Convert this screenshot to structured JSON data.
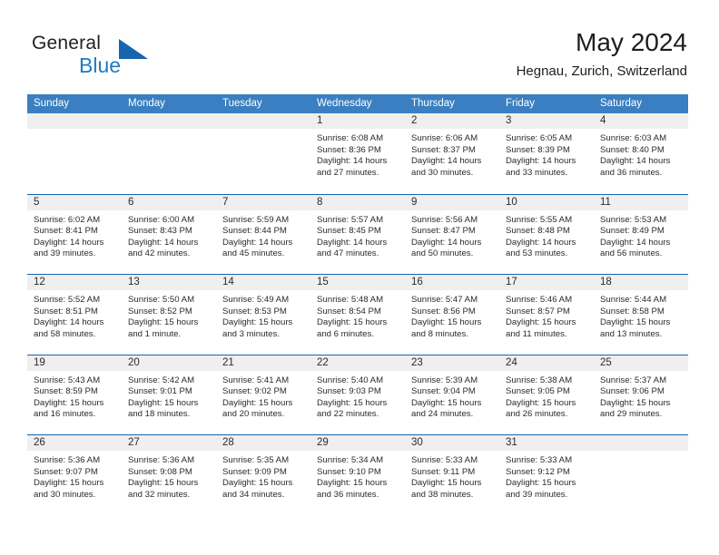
{
  "brand": {
    "name_part1": "General",
    "name_part2": "Blue"
  },
  "header": {
    "title": "May 2024",
    "location": "Hegnau, Zurich, Switzerland"
  },
  "weekdays": [
    "Sunday",
    "Monday",
    "Tuesday",
    "Wednesday",
    "Thursday",
    "Friday",
    "Saturday"
  ],
  "colors": {
    "header_blue": "#3a7fc1",
    "rule_blue": "#1665b0",
    "band_gray": "#efefef",
    "brand_blue": "#1f7ac4",
    "text": "#2b2b2b"
  },
  "weeks": [
    [
      {
        "day": "",
        "sunrise": "",
        "sunset": "",
        "daylight_line1": "",
        "daylight_line2": ""
      },
      {
        "day": "",
        "sunrise": "",
        "sunset": "",
        "daylight_line1": "",
        "daylight_line2": ""
      },
      {
        "day": "",
        "sunrise": "",
        "sunset": "",
        "daylight_line1": "",
        "daylight_line2": ""
      },
      {
        "day": "1",
        "sunrise": "Sunrise: 6:08 AM",
        "sunset": "Sunset: 8:36 PM",
        "daylight_line1": "Daylight: 14 hours",
        "daylight_line2": "and 27 minutes."
      },
      {
        "day": "2",
        "sunrise": "Sunrise: 6:06 AM",
        "sunset": "Sunset: 8:37 PM",
        "daylight_line1": "Daylight: 14 hours",
        "daylight_line2": "and 30 minutes."
      },
      {
        "day": "3",
        "sunrise": "Sunrise: 6:05 AM",
        "sunset": "Sunset: 8:39 PM",
        "daylight_line1": "Daylight: 14 hours",
        "daylight_line2": "and 33 minutes."
      },
      {
        "day": "4",
        "sunrise": "Sunrise: 6:03 AM",
        "sunset": "Sunset: 8:40 PM",
        "daylight_line1": "Daylight: 14 hours",
        "daylight_line2": "and 36 minutes."
      }
    ],
    [
      {
        "day": "5",
        "sunrise": "Sunrise: 6:02 AM",
        "sunset": "Sunset: 8:41 PM",
        "daylight_line1": "Daylight: 14 hours",
        "daylight_line2": "and 39 minutes."
      },
      {
        "day": "6",
        "sunrise": "Sunrise: 6:00 AM",
        "sunset": "Sunset: 8:43 PM",
        "daylight_line1": "Daylight: 14 hours",
        "daylight_line2": "and 42 minutes."
      },
      {
        "day": "7",
        "sunrise": "Sunrise: 5:59 AM",
        "sunset": "Sunset: 8:44 PM",
        "daylight_line1": "Daylight: 14 hours",
        "daylight_line2": "and 45 minutes."
      },
      {
        "day": "8",
        "sunrise": "Sunrise: 5:57 AM",
        "sunset": "Sunset: 8:45 PM",
        "daylight_line1": "Daylight: 14 hours",
        "daylight_line2": "and 47 minutes."
      },
      {
        "day": "9",
        "sunrise": "Sunrise: 5:56 AM",
        "sunset": "Sunset: 8:47 PM",
        "daylight_line1": "Daylight: 14 hours",
        "daylight_line2": "and 50 minutes."
      },
      {
        "day": "10",
        "sunrise": "Sunrise: 5:55 AM",
        "sunset": "Sunset: 8:48 PM",
        "daylight_line1": "Daylight: 14 hours",
        "daylight_line2": "and 53 minutes."
      },
      {
        "day": "11",
        "sunrise": "Sunrise: 5:53 AM",
        "sunset": "Sunset: 8:49 PM",
        "daylight_line1": "Daylight: 14 hours",
        "daylight_line2": "and 56 minutes."
      }
    ],
    [
      {
        "day": "12",
        "sunrise": "Sunrise: 5:52 AM",
        "sunset": "Sunset: 8:51 PM",
        "daylight_line1": "Daylight: 14 hours",
        "daylight_line2": "and 58 minutes."
      },
      {
        "day": "13",
        "sunrise": "Sunrise: 5:50 AM",
        "sunset": "Sunset: 8:52 PM",
        "daylight_line1": "Daylight: 15 hours",
        "daylight_line2": "and 1 minute."
      },
      {
        "day": "14",
        "sunrise": "Sunrise: 5:49 AM",
        "sunset": "Sunset: 8:53 PM",
        "daylight_line1": "Daylight: 15 hours",
        "daylight_line2": "and 3 minutes."
      },
      {
        "day": "15",
        "sunrise": "Sunrise: 5:48 AM",
        "sunset": "Sunset: 8:54 PM",
        "daylight_line1": "Daylight: 15 hours",
        "daylight_line2": "and 6 minutes."
      },
      {
        "day": "16",
        "sunrise": "Sunrise: 5:47 AM",
        "sunset": "Sunset: 8:56 PM",
        "daylight_line1": "Daylight: 15 hours",
        "daylight_line2": "and 8 minutes."
      },
      {
        "day": "17",
        "sunrise": "Sunrise: 5:46 AM",
        "sunset": "Sunset: 8:57 PM",
        "daylight_line1": "Daylight: 15 hours",
        "daylight_line2": "and 11 minutes."
      },
      {
        "day": "18",
        "sunrise": "Sunrise: 5:44 AM",
        "sunset": "Sunset: 8:58 PM",
        "daylight_line1": "Daylight: 15 hours",
        "daylight_line2": "and 13 minutes."
      }
    ],
    [
      {
        "day": "19",
        "sunrise": "Sunrise: 5:43 AM",
        "sunset": "Sunset: 8:59 PM",
        "daylight_line1": "Daylight: 15 hours",
        "daylight_line2": "and 16 minutes."
      },
      {
        "day": "20",
        "sunrise": "Sunrise: 5:42 AM",
        "sunset": "Sunset: 9:01 PM",
        "daylight_line1": "Daylight: 15 hours",
        "daylight_line2": "and 18 minutes."
      },
      {
        "day": "21",
        "sunrise": "Sunrise: 5:41 AM",
        "sunset": "Sunset: 9:02 PM",
        "daylight_line1": "Daylight: 15 hours",
        "daylight_line2": "and 20 minutes."
      },
      {
        "day": "22",
        "sunrise": "Sunrise: 5:40 AM",
        "sunset": "Sunset: 9:03 PM",
        "daylight_line1": "Daylight: 15 hours",
        "daylight_line2": "and 22 minutes."
      },
      {
        "day": "23",
        "sunrise": "Sunrise: 5:39 AM",
        "sunset": "Sunset: 9:04 PM",
        "daylight_line1": "Daylight: 15 hours",
        "daylight_line2": "and 24 minutes."
      },
      {
        "day": "24",
        "sunrise": "Sunrise: 5:38 AM",
        "sunset": "Sunset: 9:05 PM",
        "daylight_line1": "Daylight: 15 hours",
        "daylight_line2": "and 26 minutes."
      },
      {
        "day": "25",
        "sunrise": "Sunrise: 5:37 AM",
        "sunset": "Sunset: 9:06 PM",
        "daylight_line1": "Daylight: 15 hours",
        "daylight_line2": "and 29 minutes."
      }
    ],
    [
      {
        "day": "26",
        "sunrise": "Sunrise: 5:36 AM",
        "sunset": "Sunset: 9:07 PM",
        "daylight_line1": "Daylight: 15 hours",
        "daylight_line2": "and 30 minutes."
      },
      {
        "day": "27",
        "sunrise": "Sunrise: 5:36 AM",
        "sunset": "Sunset: 9:08 PM",
        "daylight_line1": "Daylight: 15 hours",
        "daylight_line2": "and 32 minutes."
      },
      {
        "day": "28",
        "sunrise": "Sunrise: 5:35 AM",
        "sunset": "Sunset: 9:09 PM",
        "daylight_line1": "Daylight: 15 hours",
        "daylight_line2": "and 34 minutes."
      },
      {
        "day": "29",
        "sunrise": "Sunrise: 5:34 AM",
        "sunset": "Sunset: 9:10 PM",
        "daylight_line1": "Daylight: 15 hours",
        "daylight_line2": "and 36 minutes."
      },
      {
        "day": "30",
        "sunrise": "Sunrise: 5:33 AM",
        "sunset": "Sunset: 9:11 PM",
        "daylight_line1": "Daylight: 15 hours",
        "daylight_line2": "and 38 minutes."
      },
      {
        "day": "31",
        "sunrise": "Sunrise: 5:33 AM",
        "sunset": "Sunset: 9:12 PM",
        "daylight_line1": "Daylight: 15 hours",
        "daylight_line2": "and 39 minutes."
      },
      {
        "day": "",
        "sunrise": "",
        "sunset": "",
        "daylight_line1": "",
        "daylight_line2": ""
      }
    ]
  ]
}
